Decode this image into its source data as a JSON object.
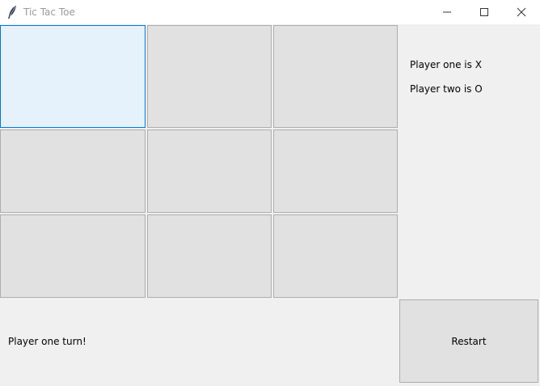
{
  "window": {
    "title": "Tic Tac Toe",
    "icon": "feather-icon"
  },
  "board": {
    "cells": [
      {
        "row": 1,
        "col": 1,
        "value": "",
        "focused": true
      },
      {
        "row": 1,
        "col": 2,
        "value": ""
      },
      {
        "row": 1,
        "col": 3,
        "value": ""
      },
      {
        "row": 2,
        "col": 1,
        "value": ""
      },
      {
        "row": 2,
        "col": 2,
        "value": ""
      },
      {
        "row": 2,
        "col": 3,
        "value": ""
      },
      {
        "row": 3,
        "col": 1,
        "value": ""
      },
      {
        "row": 3,
        "col": 2,
        "value": ""
      },
      {
        "row": 3,
        "col": 3,
        "value": ""
      }
    ]
  },
  "info": {
    "player_one": "Player one is X",
    "player_two": "Player two is O"
  },
  "status": {
    "turn_text": "Player one turn!"
  },
  "controls": {
    "restart_label": "Restart"
  },
  "colors": {
    "focus_border": "#0078d7",
    "focus_fill": "#e5f1fb",
    "button_fill": "#e1e1e1"
  }
}
